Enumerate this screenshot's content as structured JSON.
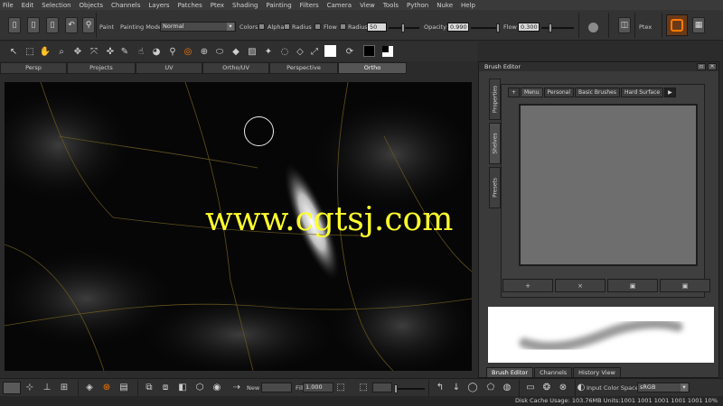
{
  "menubar": {
    "items": [
      "File",
      "Edit",
      "Selection",
      "Objects",
      "Channels",
      "Layers",
      "Patches",
      "Ptex",
      "Shading",
      "Painting",
      "Filters",
      "Camera",
      "View",
      "Tools",
      "Python",
      "Nuke",
      "Help"
    ]
  },
  "paint_toolbar": {
    "paint_label": "Paint",
    "painting_mode_label": "Painting Mode",
    "painting_mode_value": "Normal",
    "colors_label": "Colors",
    "alpha_label": "Alpha",
    "radius_check_label": "Radius",
    "flow_check_label": "Flow",
    "radius_label": "Radius",
    "radius_value": "50",
    "opacity_label": "Opacity",
    "opacity_value": "0.990",
    "flow_label": "Flow",
    "flow_value": "0.300",
    "ptex_label": "Ptex"
  },
  "view_tabs": [
    "Persp",
    "Projects",
    "UV",
    "Ortho/UV",
    "Perspective",
    "Ortho"
  ],
  "viewport": {
    "watermark": "www.cgtsj.com"
  },
  "brush_editor": {
    "title": "Brush Editor",
    "side_tabs": [
      "Properties",
      "Shelves",
      "Presets"
    ],
    "shelf_tabs": [
      "Menu",
      "Personal",
      "Basic Brushes",
      "Hard Surface"
    ],
    "buttons": [
      "+",
      "×",
      "▣",
      "▣"
    ],
    "bottom_tabs": [
      "Brush Editor",
      "Channels",
      "History View"
    ]
  },
  "bottom_toolbar": {
    "new_label": "New",
    "fill_label": "Fill",
    "fill_value": "1.000",
    "input_color_space_label": "Input Color Space",
    "input_color_space_value": "sRGB"
  },
  "status": {
    "text": "Disk Cache Usage: 103.76MB  Units:1001  1001  1001  1001  1001 10%"
  },
  "colors": {
    "accent": "#ff7a00",
    "watermark": "#ffff2b"
  }
}
